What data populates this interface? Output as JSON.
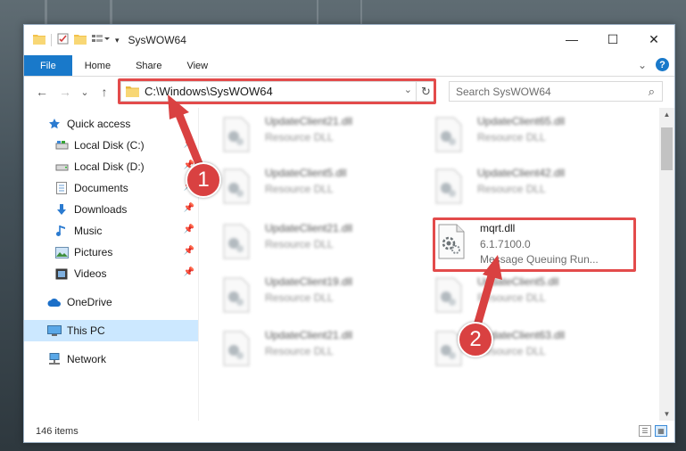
{
  "window": {
    "title": "SysWOW64",
    "minimize_glyph": "—",
    "maximize_glyph": "☐",
    "close_glyph": "✕"
  },
  "ribbon": {
    "tabs": [
      "File",
      "Home",
      "Share",
      "View"
    ],
    "expand_glyph": "⌄",
    "help_glyph": "?"
  },
  "nav": {
    "back_glyph": "←",
    "forward_glyph": "→",
    "recent_glyph": "⌄",
    "up_glyph": "↑",
    "address": "C:\\Windows\\SysWOW64",
    "address_dropdown_glyph": "⌄",
    "refresh_glyph": "↻",
    "search_placeholder": "Search SysWOW64"
  },
  "sidebar": {
    "items": [
      {
        "label": "Quick access",
        "icon": "star-icon"
      },
      {
        "label": "Local Disk (C:)",
        "icon": "drive-icon"
      },
      {
        "label": "Local Disk (D:)",
        "icon": "drive-icon"
      },
      {
        "label": "Documents",
        "icon": "documents-icon"
      },
      {
        "label": "Downloads",
        "icon": "download-icon"
      },
      {
        "label": "Music",
        "icon": "music-icon"
      },
      {
        "label": "Pictures",
        "icon": "pictures-icon"
      },
      {
        "label": "Videos",
        "icon": "videos-icon"
      },
      {
        "label": "OneDrive",
        "icon": "cloud-icon"
      },
      {
        "label": "This PC",
        "icon": "pc-icon"
      },
      {
        "label": "Network",
        "icon": "network-icon"
      }
    ]
  },
  "files": [
    {
      "name": "UpdateClient21.dll",
      "type": "Resource DLL"
    },
    {
      "name": "UpdateClient65.dll",
      "type": "Resource DLL"
    },
    {
      "name": "UpdateClient5.dll",
      "type": "Resource DLL"
    },
    {
      "name": "UpdateClient42.dll",
      "type": "Resource DLL"
    },
    {
      "name": "UpdateClient21.dll",
      "type": "Resource DLL"
    },
    {
      "name": "mqrt.dll",
      "version": "6.1.7100.0",
      "description": "Message Queuing Run..."
    },
    {
      "name": "UpdateClient19.dll",
      "type": "Resource DLL"
    },
    {
      "name": "UpdateClient5.dll",
      "type": "Resource DLL"
    },
    {
      "name": "UpdateClient21.dll",
      "type": "Resource DLL"
    },
    {
      "name": "UpdateClient63.dll",
      "type": "Resource DLL"
    }
  ],
  "status": {
    "item_count": "146 items"
  },
  "annotations": {
    "step1": "1",
    "step2": "2",
    "accent": "#d94141"
  },
  "colors": {
    "file_tab": "#1979ca",
    "selection": "#cce8ff",
    "highlight": "#e34b4b"
  }
}
